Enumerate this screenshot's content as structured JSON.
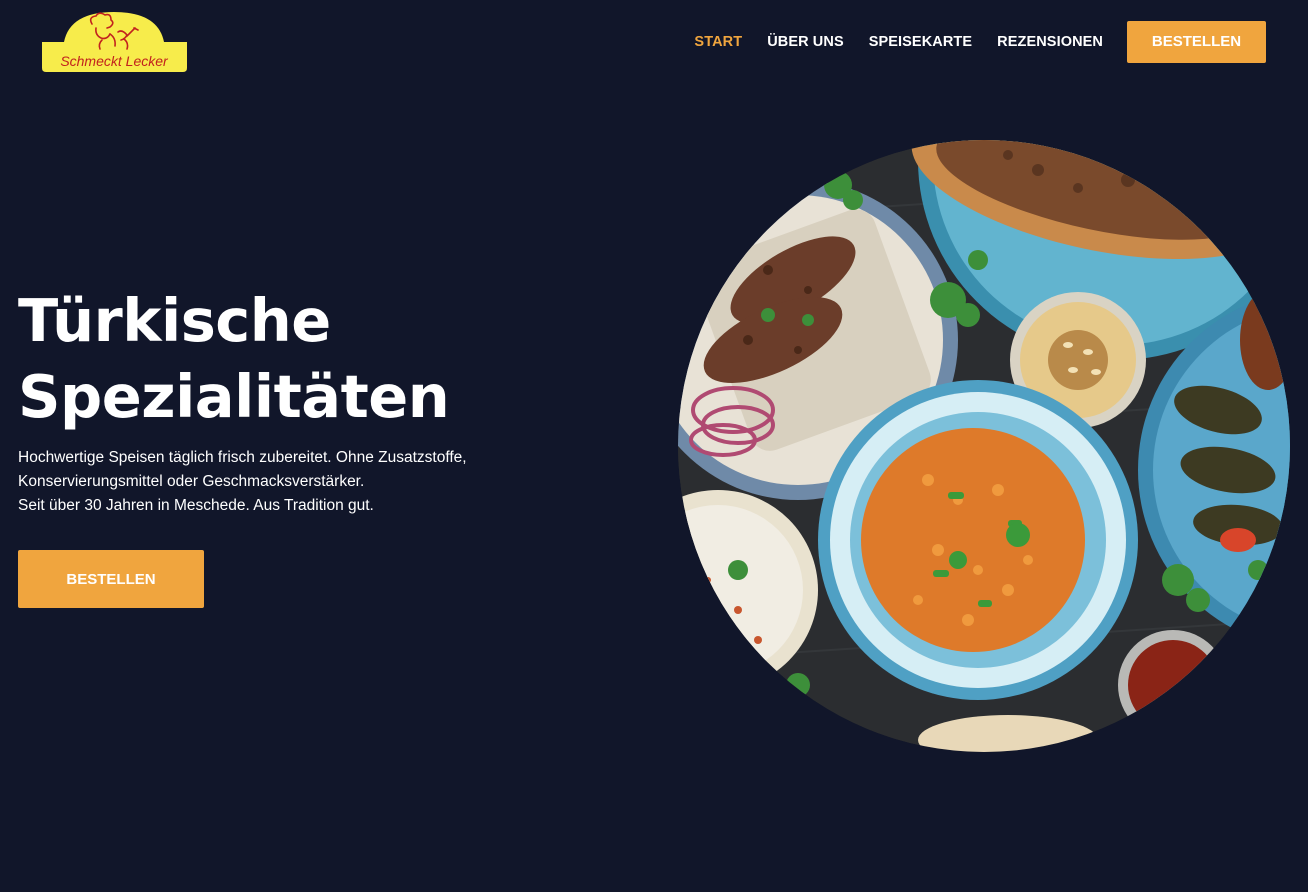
{
  "brand": {
    "logo_text": "Schmeckt Lecker",
    "logo_icon": "chef-icon",
    "logo_color": "#f7ec4b",
    "logo_text_color": "#c2221e"
  },
  "nav": {
    "items": [
      {
        "label": "START",
        "active": true
      },
      {
        "label": "ÜBER UNS",
        "active": false
      },
      {
        "label": "SPEISEKARTE",
        "active": false
      },
      {
        "label": "REZENSIONEN",
        "active": false
      }
    ],
    "cta_label": "BESTELLEN"
  },
  "hero": {
    "title_line1": "Türkische",
    "title_line2": "Spezialitäten",
    "text_line1": "Hochwertige Speisen täglich frisch zubereitet. Ohne Zusatzstoffe,",
    "text_line2": "Konservierungsmittel oder Geschmacksverstärker.",
    "text_line3": "Seit über 30 Jahren in Meschede. Aus Tradition gut.",
    "cta_label": "BESTELLEN"
  },
  "colors": {
    "background": "#11162a",
    "accent": "#f0a53e",
    "text": "#ffffff"
  }
}
